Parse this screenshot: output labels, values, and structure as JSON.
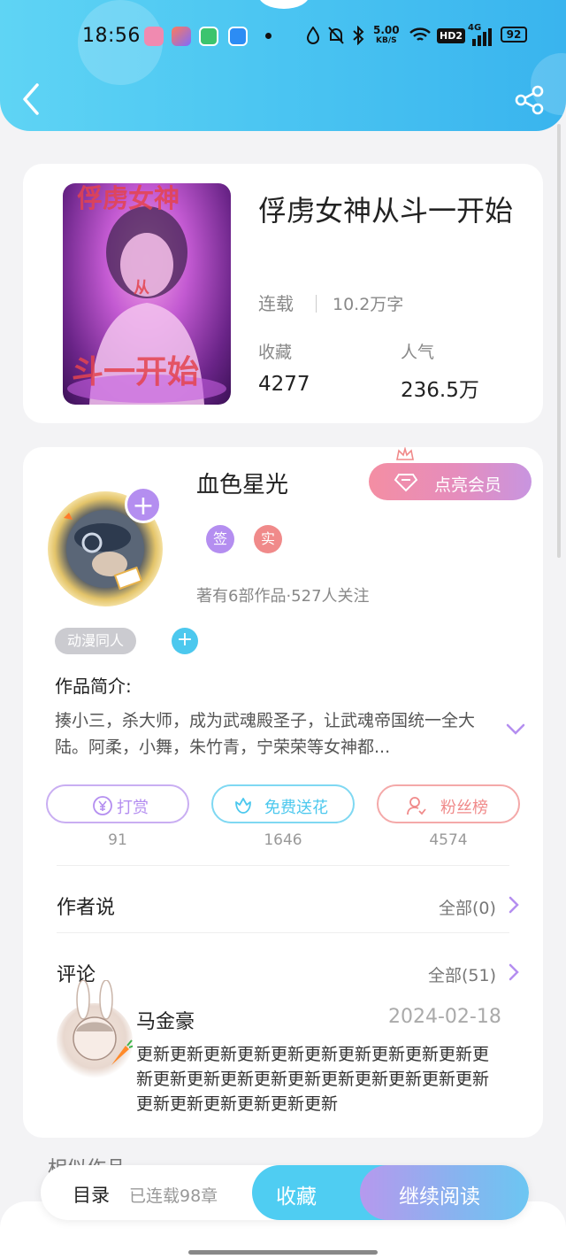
{
  "status_bar": {
    "time": "18:56",
    "net_speed_value": "5.00",
    "net_speed_unit": "KB/S",
    "hd_label": "HD2",
    "signal_label": "4G",
    "battery": "92"
  },
  "header": {
    "back_icon": "chevron-left-icon",
    "share_icon": "share-icon"
  },
  "book": {
    "cover_text_top": "俘虏女神",
    "cover_text_mid": "从",
    "cover_text_bottom": "斗一开始",
    "title": "俘虏女神从斗一开始",
    "status": "连载",
    "word_count": "10.2万字",
    "favorites_label": "收藏",
    "favorites_value": "4277",
    "popularity_label": "人气",
    "popularity_value": "236.5万"
  },
  "author": {
    "name": "血色星光",
    "vip_button": "点亮会员",
    "badge_signed": "签",
    "badge_verified": "实",
    "meta": "著有6部作品·527人关注",
    "tag": "动漫同人",
    "follow_plus": "+",
    "tag_add": "+"
  },
  "intro": {
    "title": "作品简介:",
    "text": "揍小三，杀大师，成为武魂殿圣子，让武魂帝国统一全大陆。阿柔，小舞，朱竹青，宁荣荣等女神都..."
  },
  "actions": [
    {
      "label": "打赏",
      "count": "91",
      "color": "#b48ef0",
      "icon": "yen-icon"
    },
    {
      "label": "免费送花",
      "count": "1646",
      "color": "#4cc8ee",
      "icon": "flower-icon"
    },
    {
      "label": "粉丝榜",
      "count": "4574",
      "color": "#f08a8a",
      "icon": "fans-icon"
    }
  ],
  "author_says": {
    "title": "作者说",
    "more": "全部(0)"
  },
  "comments": {
    "title": "评论",
    "more": "全部(51)",
    "items": [
      {
        "user": "马金豪",
        "date": "2024-02-18",
        "text": "更新更新更新更新更新更新更新更新更新更新更新更新更新更新更新更新更新更新更新更新更新更新更新更新更新更新更新"
      }
    ]
  },
  "next_section_title": "相似作品",
  "bottom_bar": {
    "toc": "目录",
    "chapters": "已连载98章",
    "favorite": "收藏",
    "continue": "继续阅读"
  },
  "colors": {
    "header_blue": "#4cc6f2",
    "vip_pink": "#f48ea3",
    "accent_purple": "#b48ef0",
    "accent_cyan": "#4cc8ee"
  }
}
